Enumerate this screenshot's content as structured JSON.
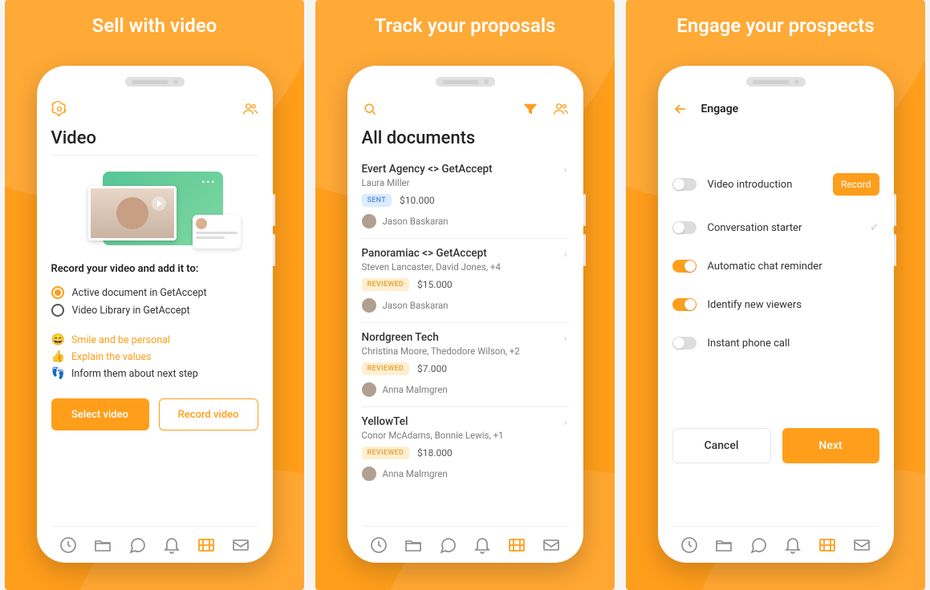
{
  "panel1": {
    "title": "Sell with video",
    "page_title": "Video",
    "record_prompt": "Record your video and add it to:",
    "radio_options": [
      {
        "label": "Active document in GetAccept",
        "checked": true
      },
      {
        "label": "Video Library in GetAccept",
        "checked": false
      }
    ],
    "tips": [
      {
        "emoji": "😄",
        "text": "Smile and be personal",
        "highlight": true
      },
      {
        "emoji": "👍",
        "text": "Explain the values",
        "highlight": true
      },
      {
        "emoji": "👣",
        "text": "Inform them about next step",
        "highlight": false
      }
    ],
    "select_button": "Select video",
    "record_button": "Record video"
  },
  "panel2": {
    "title": "Track your proposals",
    "page_title": "All documents",
    "docs": [
      {
        "title": "Evert Agency <> GetAccept",
        "subtitle": "Laura Miller",
        "status": "SENT",
        "amount": "$10.000",
        "owner": "Jason Baskaran"
      },
      {
        "title": "Panoramiac <> GetAccept",
        "subtitle": "Steven Lancaster, David Jones, +4",
        "status": "REVIEWED",
        "amount": "$15.000",
        "owner": "Jason Baskaran"
      },
      {
        "title": "Nordgreen Tech",
        "subtitle": "Christina Moore, Thedodore Wilson, +2",
        "status": "REVIEWED",
        "amount": "$7.000",
        "owner": "Anna Malmgren"
      },
      {
        "title": "YellowTel",
        "subtitle": "Conor McAdams, Bonnie Lewis, +1",
        "status": "REVIEWED",
        "amount": "$18.000",
        "owner": "Anna Malmgren"
      }
    ]
  },
  "panel3": {
    "title": "Engage your prospects",
    "page_title": "Engage",
    "rows": [
      {
        "label": "Video introduction",
        "on": false,
        "trailing": "record"
      },
      {
        "label": "Conversation starter",
        "on": false,
        "trailing": "check"
      },
      {
        "label": "Automatic chat reminder",
        "on": true,
        "trailing": "none"
      },
      {
        "label": "Identify new viewers",
        "on": true,
        "trailing": "none"
      },
      {
        "label": "Instant phone call",
        "on": false,
        "trailing": "none"
      }
    ],
    "record_label": "Record",
    "cancel": "Cancel",
    "next": "Next"
  }
}
